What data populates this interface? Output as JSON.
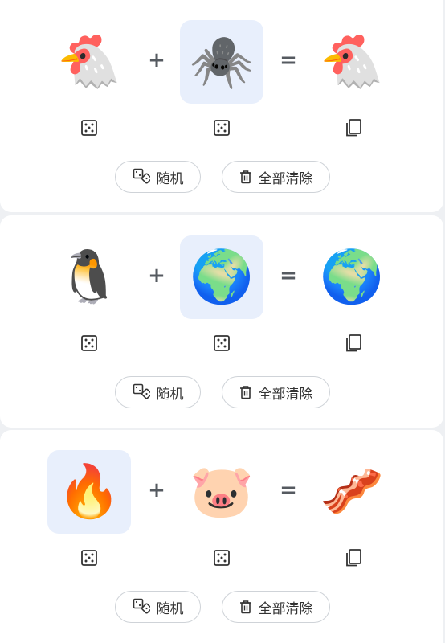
{
  "colors": {
    "background": "#eef0f3",
    "card": "#ffffff",
    "selected_slot": "#e8effc",
    "operator": "#555a60",
    "pill_border": "#cfd3d8"
  },
  "operators": {
    "plus": "+",
    "equals": "="
  },
  "buttons": {
    "random_label": "随机",
    "clear_label": "全部清除"
  },
  "icons": {
    "slot_action": "dice-icon",
    "result_action": "copy-icon",
    "random": "dice-pair-icon",
    "clear": "trash-icon"
  },
  "combos": [
    {
      "left": {
        "emoji": "🐔",
        "name": "chicken",
        "selected": false
      },
      "right": {
        "emoji": "🕷️",
        "name": "spider",
        "selected": true
      },
      "result": {
        "emoji": "🐔",
        "name": "chicken-spider"
      }
    },
    {
      "left": {
        "emoji": "🐧",
        "name": "penguin",
        "selected": false
      },
      "right": {
        "emoji": "🌍",
        "name": "globe",
        "selected": true
      },
      "result": {
        "emoji": "🌍",
        "name": "penguin-globe"
      }
    },
    {
      "left": {
        "emoji": "🔥",
        "name": "fire",
        "selected": true
      },
      "right": {
        "emoji": "🐷",
        "name": "pig",
        "selected": false
      },
      "result": {
        "emoji": "🥓",
        "name": "bacon-pan"
      }
    }
  ]
}
